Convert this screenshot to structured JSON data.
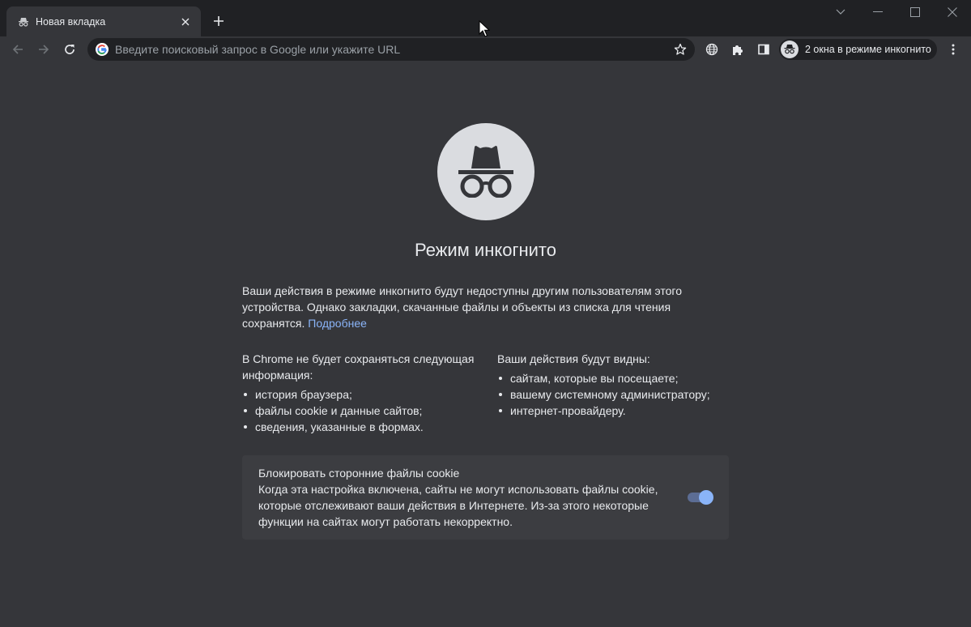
{
  "tab": {
    "title": "Новая вкладка"
  },
  "omnibox": {
    "placeholder": "Введите поисковый запрос в Google или укажите URL"
  },
  "profile": {
    "incognito_label": "2 окна в режиме инкогнито"
  },
  "page": {
    "title": "Режим инкогнито",
    "intro": "Ваши действия в режиме инкогнито будут недоступны другим пользователям этого устройства. Однако закладки, скачанные файлы и объекты из списка для чтения сохранятся.",
    "learn_more": "Подробнее",
    "not_saved": {
      "heading": "В Chrome не будет сохраняться следующая информация:",
      "items": [
        "история браузера;",
        "файлы cookie и данные сайтов;",
        "сведения, указанные в формах."
      ]
    },
    "visible_to": {
      "heading": "Ваши действия будут видны:",
      "items": [
        "сайтам, которые вы посещаете;",
        "вашему системному администратору;",
        "интернет-провайдеру."
      ]
    },
    "cookie_card": {
      "title": "Блокировать сторонние файлы cookie",
      "description": "Когда эта настройка включена, сайты не могут использовать файлы cookie, которые отслеживают ваши действия в Интернете. Из-за этого некоторые функции на сайтах могут работать некорректно.",
      "toggle_on": true
    }
  },
  "colors": {
    "frame": "#202124",
    "background": "#35363a",
    "text": "#e8eaed",
    "link": "#8ab4f8",
    "card": "#3c3d41",
    "hero": "#dadce0"
  }
}
